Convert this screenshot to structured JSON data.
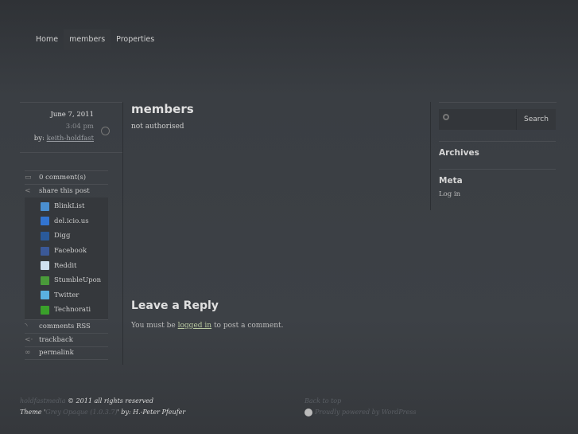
{
  "nav": {
    "items": [
      "Home",
      "members",
      "Properties"
    ]
  },
  "post": {
    "date": "June 7, 2011",
    "time": "3:04 pm",
    "by_label": "by:",
    "author": "keith-holdfast"
  },
  "actions": {
    "comments": "0 comment(s)",
    "share": "share this post",
    "rss": "comments RSS",
    "trackback": "trackback",
    "permalink": "permalink"
  },
  "share_items": [
    {
      "label": "BlinkList",
      "color": "#4a8fd0"
    },
    {
      "label": "del.icio.us",
      "color": "#3274d0"
    },
    {
      "label": "Digg",
      "color": "#2a5a9a"
    },
    {
      "label": "Facebook",
      "color": "#3b5998"
    },
    {
      "label": "Reddit",
      "color": "#cfe0f0"
    },
    {
      "label": "StumbleUpon",
      "color": "#4a9a3a"
    },
    {
      "label": "Twitter",
      "color": "#5ab0e0"
    },
    {
      "label": "Technorati",
      "color": "#3aa02a"
    }
  ],
  "main": {
    "title": "members",
    "text": "not authorised"
  },
  "reply": {
    "title": "Leave a Reply",
    "pre": "You must be ",
    "link": "logged in",
    "post": " to post a comment."
  },
  "sidebar": {
    "search_button": "Search",
    "archives": "Archives",
    "meta": "Meta",
    "login": "Log in"
  },
  "footer": {
    "site": "holdfastmedia",
    "copy": " © 2011 all rights reserved",
    "theme_pre": "Theme '",
    "theme": "Grey Opaque (1.0.3.7)",
    "theme_post": "' by: H.-Peter Pfeufer",
    "back": "Back to top",
    "powered": "Proudly powered by WordPress"
  }
}
